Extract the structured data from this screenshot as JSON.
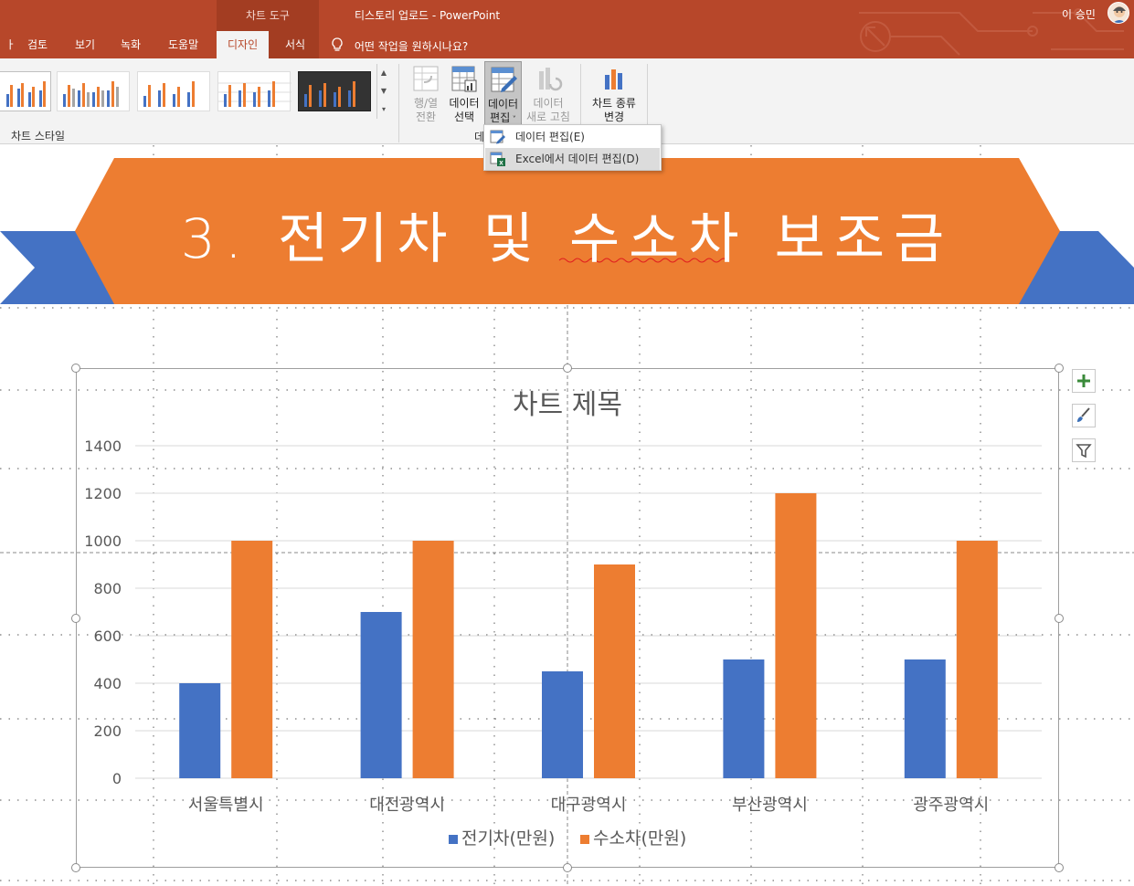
{
  "titlebar": {
    "chart_tools_label": "차트 도구",
    "document_title": "티스토리 업로드  -  PowerPoint",
    "user_name": "이 승민"
  },
  "tabs": [
    {
      "label": "검토"
    },
    {
      "label": "보기"
    },
    {
      "label": "녹화"
    },
    {
      "label": "도움말"
    },
    {
      "label": "디자인",
      "active": true
    },
    {
      "label": "서식"
    }
  ],
  "tell_me": "어떤 작업을 원하시나요?",
  "ribbon": {
    "chart_style_group": "차트 스타일",
    "switch_row_col": {
      "line1": "행/열",
      "line2": "전환"
    },
    "select_data": {
      "line1": "데이터",
      "line2": "선택"
    },
    "edit_data": {
      "line1": "데이터",
      "line2": "편집"
    },
    "refresh_data": {
      "line1": "데이터",
      "line2": "새로 고침"
    },
    "change_chart_type": {
      "line1": "차트 종류",
      "line2": "변경"
    },
    "data_group_label": "데"
  },
  "dropdown": {
    "items": [
      {
        "label": "데이터 편집(E)"
      },
      {
        "label": "Excel에서 데이터 편집(D)"
      }
    ]
  },
  "slide": {
    "title": "3. 전기차 및 수소차 보조금"
  },
  "colors": {
    "accent_red": "#b7472a",
    "banner_orange": "#ed7d31",
    "banner_blue": "#4472c4",
    "series_blue": "#4472c4",
    "series_orange": "#ed7d31"
  },
  "chart_data": {
    "type": "bar",
    "title": "차트 제목",
    "categories": [
      "서울특별시",
      "대전광역시",
      "대구광역시",
      "부산광역시",
      "광주광역시"
    ],
    "series": [
      {
        "name": "전기차(만원)",
        "values": [
          400,
          700,
          450,
          500,
          500
        ]
      },
      {
        "name": "수소차(만원)",
        "values": [
          1000,
          1000,
          900,
          1200,
          1000
        ]
      }
    ],
    "ylim": [
      0,
      1400
    ],
    "yticks": [
      0,
      200,
      400,
      600,
      800,
      1000,
      1200,
      1400
    ],
    "legend": "bottom",
    "grid": true
  }
}
